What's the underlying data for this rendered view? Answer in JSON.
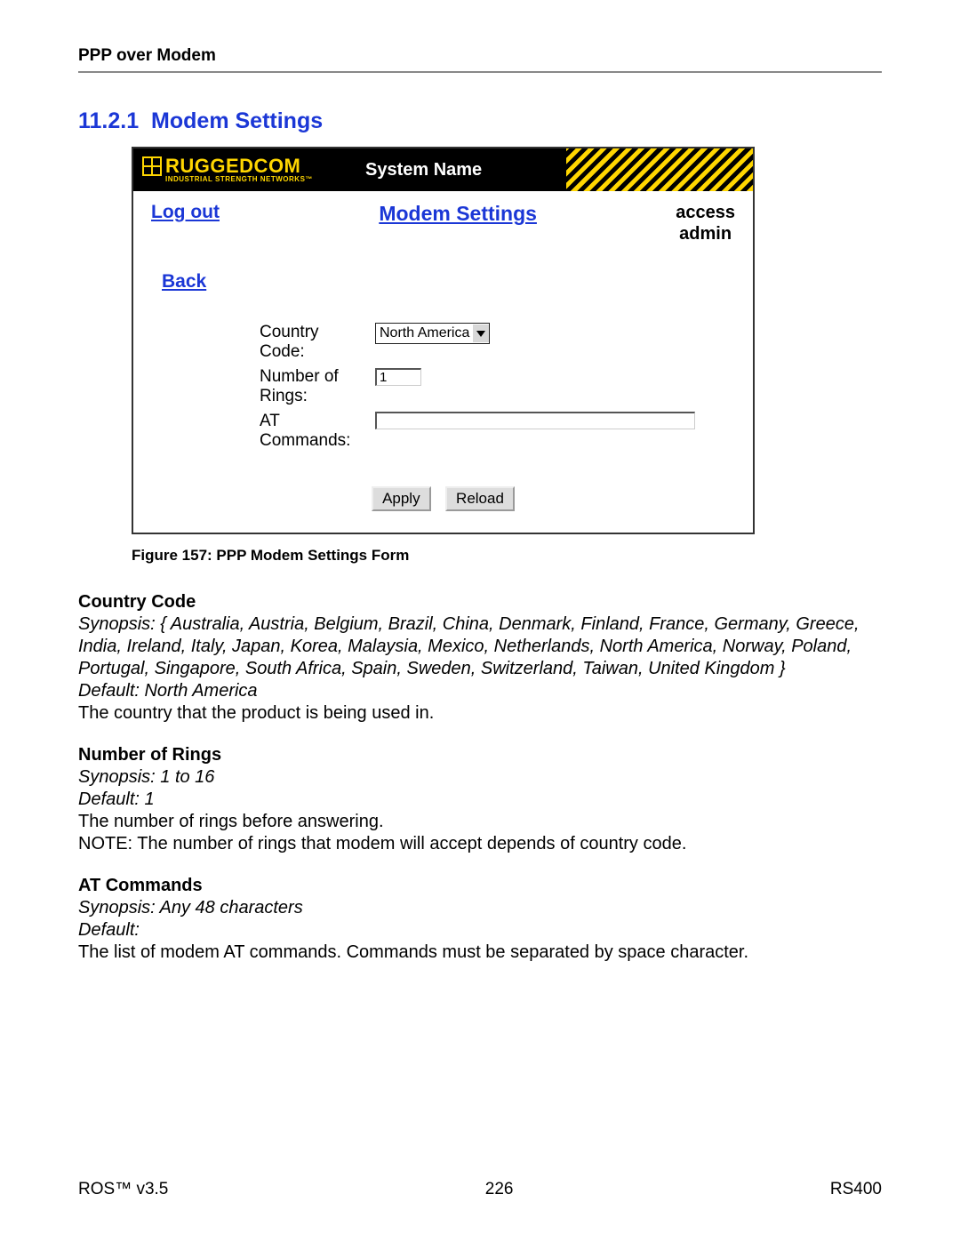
{
  "header": {
    "title": "PPP over Modem"
  },
  "section": {
    "number": "11.2.1",
    "title": "Modem Settings"
  },
  "shot": {
    "logo_main": "RUGGEDCOM",
    "logo_sub": "INDUSTRIAL STRENGTH NETWORKS™",
    "system_name": "System Name",
    "logout": "Log out",
    "page_title": "Modem Settings",
    "access_line1": "access",
    "access_line2": "admin",
    "back": "Back",
    "form": {
      "country_label": "Country Code:",
      "country_value": "North America",
      "rings_label": "Number of Rings:",
      "rings_value": "1",
      "at_label": "AT Commands:",
      "at_value": ""
    },
    "buttons": {
      "apply": "Apply",
      "reload": "Reload"
    }
  },
  "caption": "Figure 157: PPP Modem Settings Form",
  "desc": {
    "cc_h": "Country Code",
    "cc_syn": "Synopsis: { Australia, Austria, Belgium, Brazil, China, Denmark, Finland, France, Germany, Greece, India, Ireland, Italy, Japan, Korea, Malaysia, Mexico, Netherlands, North America, Norway, Poland, Portugal, Singapore, South Africa, Spain, Sweden, Switzerland, Taiwan, United Kingdom }",
    "cc_def": "Default: North America",
    "cc_txt": "The country that the product is being used in.",
    "nr_h": "Number of Rings",
    "nr_syn": "Synopsis: 1 to 16",
    "nr_def": "Default: 1",
    "nr_txt1": "The number of rings before answering.",
    "nr_txt2": "NOTE: The number of rings that modem will accept depends of country code.",
    "at_h": "AT Commands",
    "at_syn": "Synopsis: Any 48 characters",
    "at_def": "Default:",
    "at_txt": "The list of modem AT commands. Commands must be separated by space character."
  },
  "footer": {
    "left": "ROS™  v3.5",
    "center": "226",
    "right": "RS400"
  }
}
